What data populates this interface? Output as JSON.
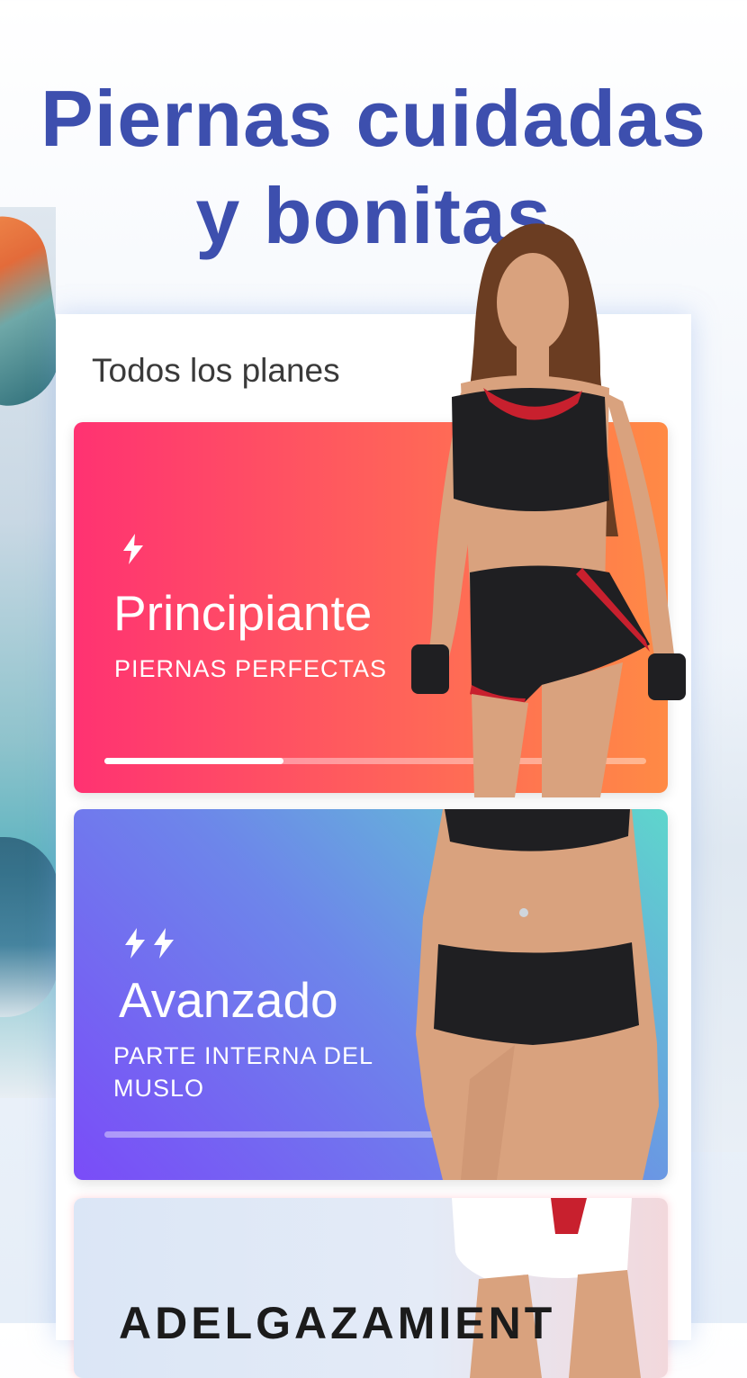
{
  "headline": {
    "line1": "Piernas cuidadas",
    "line2": "y bonitas"
  },
  "panel": {
    "title": "Todos los planes"
  },
  "plans": [
    {
      "level": "Principiante",
      "subtitle": "PIERNAS PERFECTAS",
      "bolts": 1,
      "progress": 0.33,
      "icon": "lightning-icon"
    },
    {
      "level": "Avanzado",
      "subtitle": "PARTE INTERNA DEL MUSLO",
      "bolts": 2,
      "progress": 0.0,
      "icon": "lightning-icon"
    },
    {
      "level": "ADELGAZAMIENT",
      "subtitle": "",
      "bolts": 0,
      "progress": 0.0
    }
  ],
  "colors": {
    "headline": "#3d4fae",
    "card1_start": "#ff3272",
    "card1_end": "#ff8a45",
    "card2_start": "#7a4cf8",
    "card2_end": "#5ed6cc"
  }
}
